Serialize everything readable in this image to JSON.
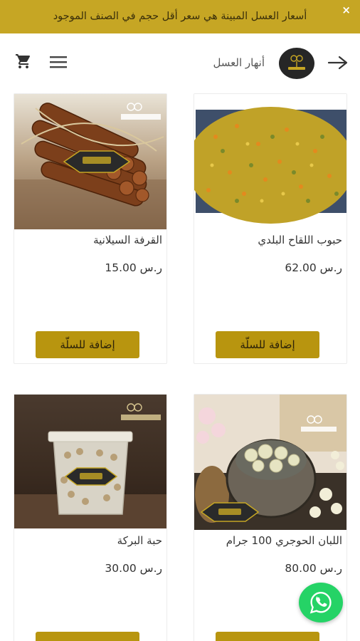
{
  "banner": {
    "text": "أسعار العسل المبينة هي سعر أقل حجم في الصنف الموجود",
    "close_label": "×"
  },
  "header": {
    "store_name": "أنهار العسل",
    "logo_alt": "honey-rivers-logo",
    "icons": [
      "cart-icon",
      "menu-icon",
      "arrow-right-icon"
    ]
  },
  "products": [
    {
      "name": "القرفة السيلانية",
      "price": "ر.س 15.00",
      "button": "إضافة للسلّة",
      "image": "cinnamon-sticks"
    },
    {
      "name": "حبوب اللقاح البلدي",
      "price": "ر.س 62.00",
      "button": "إضافة للسلّة",
      "image": "bee-pollen"
    },
    {
      "name": "حبة البركة",
      "price": "ر.س 30.00",
      "button": "",
      "image": "nigella-seeds-jar"
    },
    {
      "name": "اللبان الحوجري 100 جرام",
      "price": "ر.س 80.00",
      "button": "",
      "image": "frankincense"
    }
  ],
  "colors": {
    "banner": "#c6a624",
    "button": "#b8950f",
    "whatsapp": "#25d366"
  }
}
